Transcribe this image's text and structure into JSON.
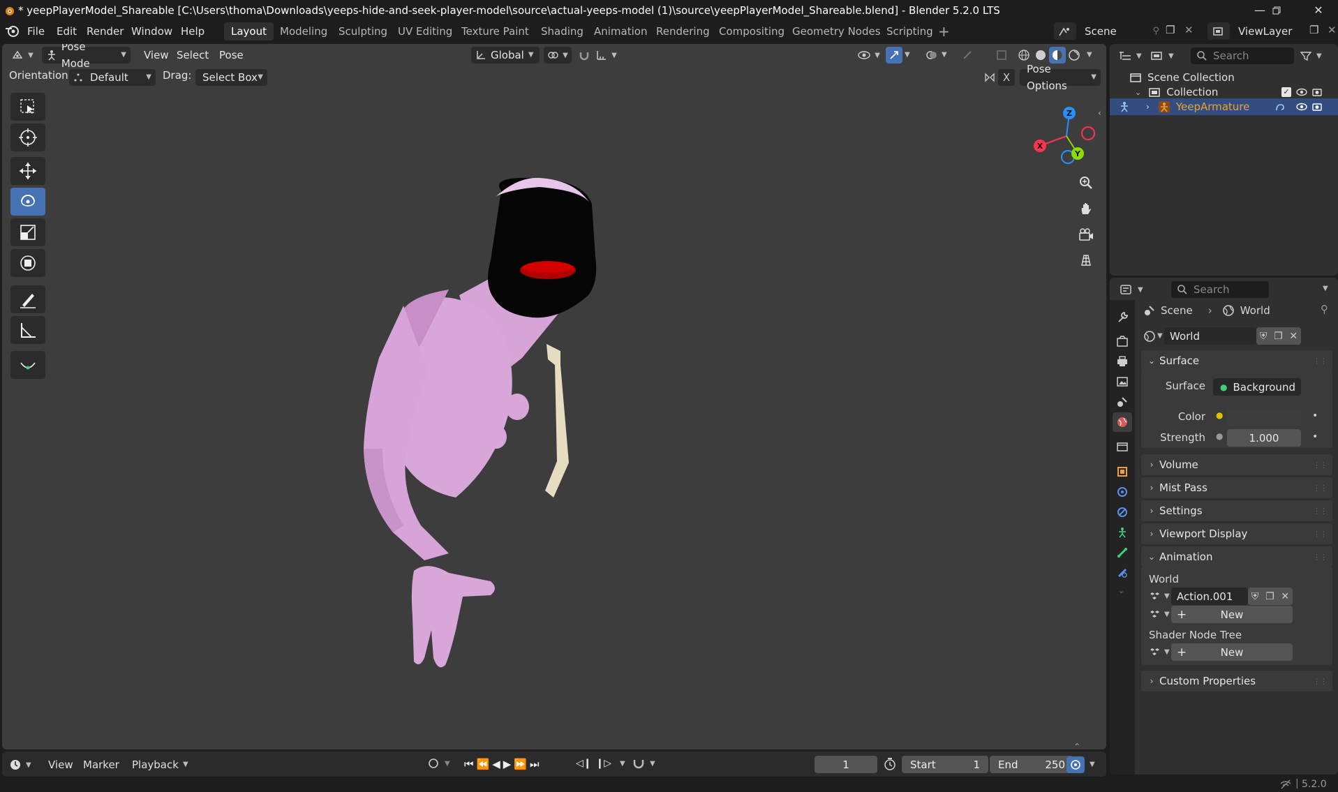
{
  "window": {
    "title": "* yeepPlayerModel_Shareable [C:\\Users\\thoma\\Downloads\\yeeps-hide-and-seek-player-model\\source\\actual-yeeps-model (1)\\source\\yeepPlayerModel_Shareable.blend] - Blender 5.2.0 LTS",
    "controls": [
      "minimize-icon",
      "restore-icon",
      "close-icon"
    ]
  },
  "menubar": {
    "menus": [
      "File",
      "Edit",
      "Render",
      "Window",
      "Help"
    ],
    "workspaces": [
      "Layout",
      "Modeling",
      "Sculpting",
      "UV Editing",
      "Texture Paint",
      "Shading",
      "Animation",
      "Rendering",
      "Compositing",
      "Geometry Nodes",
      "Scripting"
    ],
    "active_workspace": "Layout",
    "scene": "Scene",
    "view_layer": "ViewLayer"
  },
  "viewport": {
    "mode": "Pose Mode",
    "menus": [
      "View",
      "Select",
      "Pose"
    ],
    "transform_orientation": "Global",
    "orientation_label": "Orientation:",
    "orientation_value": "Default",
    "drag_label": "Drag:",
    "drag_value": "Select Box",
    "mirror_x": "X",
    "pose_options": "Pose Options",
    "gizmo_axes": {
      "z": "Z",
      "x": "X",
      "y": "Y"
    },
    "axis_colors": {
      "x": "#ff3352",
      "y": "#8bdc00",
      "z": "#2890ff"
    },
    "bg_color": "#3d3d3d"
  },
  "timeline": {
    "menus": [
      "View",
      "Marker",
      "Playback"
    ],
    "current_frame": "1",
    "start_label": "Start",
    "start": "1",
    "end_label": "End",
    "end": "250"
  },
  "outliner": {
    "search_placeholder": "Search",
    "items": [
      {
        "label": "Scene Collection",
        "level": 0
      },
      {
        "label": "Collection",
        "level": 1
      },
      {
        "label": "YeepArmature",
        "level": 2,
        "selected": true
      }
    ]
  },
  "properties": {
    "search_placeholder": "Search",
    "breadcrumb": [
      "Scene",
      "World"
    ],
    "world_name": "World",
    "panels": {
      "surface": "Surface",
      "volume": "Volume",
      "mist_pass": "Mist Pass",
      "settings": "Settings",
      "viewport_display": "Viewport Display",
      "animation": "Animation",
      "custom_properties": "Custom Properties"
    },
    "surface_label": "Surface",
    "surface_value": "Background",
    "color_label": "Color",
    "strength_label": "Strength",
    "strength_value": "1.000",
    "anim_world_label": "World",
    "action_name": "Action.001",
    "new_label": "New",
    "shader_tree_label": "Shader Node Tree"
  },
  "statusbar": {
    "version": "5.2.0"
  },
  "colors": {
    "accent": "#4772b3",
    "selection": "#334d80",
    "model_pink": "#d9a6d9",
    "head_black": "#050505",
    "mouth_red": "#b00000",
    "tie_cream": "#e6dcc2",
    "armature_orange": "#f0a030"
  }
}
